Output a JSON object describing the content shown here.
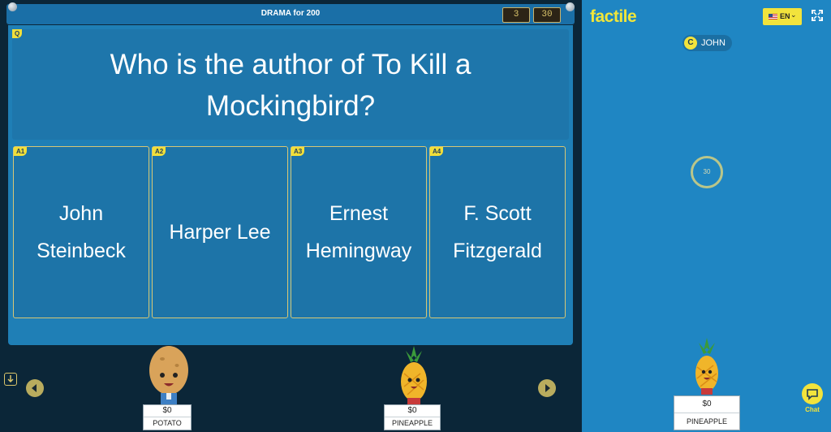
{
  "header": {
    "title": "DRAMA for 200",
    "counter_left": "3",
    "counter_right": "30"
  },
  "question": {
    "tag": "Q",
    "text": "Who is the author of To Kill a Mockingbird?"
  },
  "answers": [
    {
      "tag": "A1",
      "text": "John Steinbeck"
    },
    {
      "tag": "A2",
      "text": "Harper Lee"
    },
    {
      "tag": "A3",
      "text": "Ernest Hemingway"
    },
    {
      "tag": "A4",
      "text": "F. Scott Fitzgerald"
    }
  ],
  "players": [
    {
      "name": "POTATO",
      "score": "$0"
    },
    {
      "name": "PINEAPPLE",
      "score": "$0"
    }
  ],
  "sidebar": {
    "logo": "factile",
    "lang": "EN",
    "player_badge": "C",
    "player_name": "JOHN",
    "timer": "30",
    "avatar": {
      "score": "$0",
      "name": "PINEAPPLE"
    },
    "chat_label": "Chat"
  },
  "icons": [
    "download-icon",
    "prev-arrow-icon",
    "next-arrow-icon",
    "flag-icon",
    "chevron-down-icon",
    "fullscreen-icon",
    "chat-icon",
    "potato-avatar-icon",
    "pineapple-avatar-icon"
  ],
  "colors": {
    "accent": "#f2e33c",
    "board": "#1f7fb6",
    "panel": "#1f86c3",
    "background": "#0b2638"
  }
}
